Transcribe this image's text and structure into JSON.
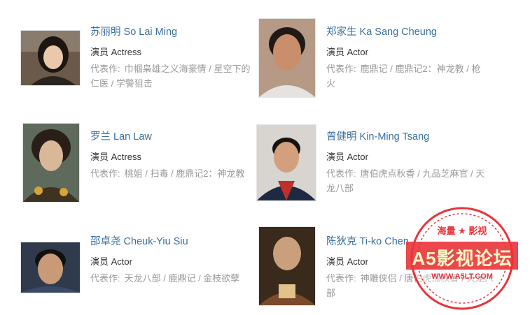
{
  "works_prefix": "代表作:",
  "actors": [
    {
      "name": "苏丽明 So Lai Ming",
      "role": "演员 Actress",
      "works_line1": "巾帼枭雄之义海豪情 / 星空下的",
      "works_line2": "仁医 / 学警狙击"
    },
    {
      "name": "郑家生 Ka Sang Cheung",
      "role": "演员 Actor",
      "works_line1": "鹿鼎记 / 鹿鼎记2：神龙教 / 枪",
      "works_line2": "火"
    },
    {
      "name": "罗兰 Lan Law",
      "role": "演员 Actress",
      "works_line1": "桃姐 / 扫毒 / 鹿鼎记2：神龙教",
      "works_line2": ""
    },
    {
      "name": "曾健明 Kin-Ming Tsang",
      "role": "演员 Actor",
      "works_line1": "唐伯虎点秋香 / 九品芝麻官 / 天",
      "works_line2": "龙八部"
    },
    {
      "name": "邵卓尧 Cheuk-Yiu Siu",
      "role": "演员 Actor",
      "works_line1": "天龙八部 / 鹿鼎记 / 金枝欲孽",
      "works_line2": ""
    },
    {
      "name": "陈狄克 Ti-ko Chen",
      "role": "演员 Actor",
      "works_line1": "神雕侠侣 / 唐伯虎点秋香 / 天龙八部",
      "works_line2": ""
    }
  ],
  "watermark": {
    "top_text": "海量 ★ 影视",
    "main_text": "A5影视论坛",
    "url_text": "WWW.A5LT.COM"
  }
}
